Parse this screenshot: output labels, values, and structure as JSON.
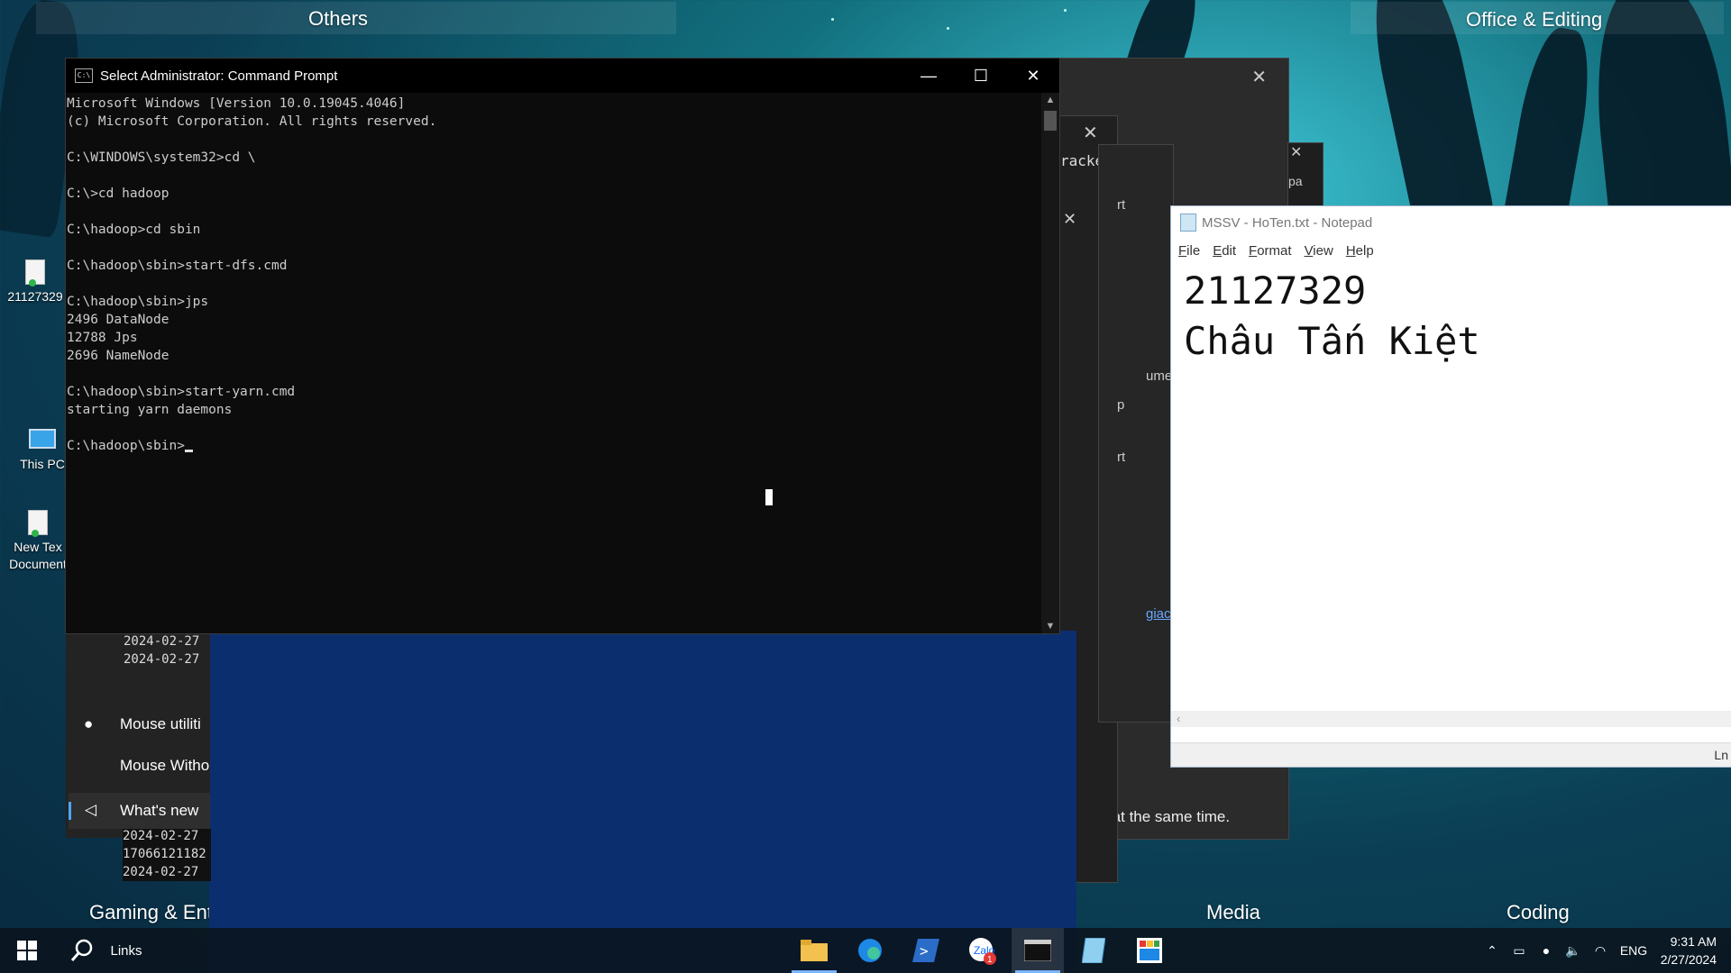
{
  "desktop": {
    "groups": {
      "others": "Others",
      "office": "Office & Editing",
      "gaming": "Gaming & Ent",
      "media": "Media",
      "coding": "Coding"
    },
    "icons": [
      {
        "label": "21127329",
        "icon": "text-document-icon"
      },
      {
        "label": "This PC",
        "icon": "this-pc-icon"
      },
      {
        "label": "New Tex Document",
        "icon": "text-document-icon"
      }
    ]
  },
  "background_windows": {
    "fragments": [
      "racke",
      "pa",
      "rt",
      "ume",
      "p",
      "rt",
      "giaco",
      "es at the same time."
    ],
    "log_lines_top": [
      "2024-02-27",
      "2024-02-27"
    ],
    "log_lines_bottom": [
      "2024-02-27",
      "17066121182",
      "2024-02-27"
    ],
    "start_items": [
      "Mouse utiliti",
      "Mouse Witho",
      "What's new"
    ]
  },
  "cmd": {
    "title": "Select Administrator: Command Prompt",
    "lines": [
      "Microsoft Windows [Version 10.0.19045.4046]",
      "(c) Microsoft Corporation. All rights reserved.",
      "",
      "C:\\WINDOWS\\system32>cd \\",
      "",
      "C:\\>cd hadoop",
      "",
      "C:\\hadoop>cd sbin",
      "",
      "C:\\hadoop\\sbin>start-dfs.cmd",
      "",
      "C:\\hadoop\\sbin>jps",
      "2496 DataNode",
      "12788 Jps",
      "2696 NameNode",
      "",
      "C:\\hadoop\\sbin>start-yarn.cmd",
      "starting yarn daemons",
      "",
      "C:\\hadoop\\sbin>"
    ]
  },
  "notepad": {
    "title": "MSSV - HoTen.txt - Notepad",
    "menu": [
      "File",
      "Edit",
      "Format",
      "View",
      "Help"
    ],
    "content": [
      "21127329",
      "Châu Tấn Kiệt"
    ],
    "status": "Ln"
  },
  "taskbar": {
    "search_label": "Links",
    "apps": [
      {
        "name": "file-explorer",
        "icon": "folder-icon"
      },
      {
        "name": "edge",
        "icon": "edge-icon"
      },
      {
        "name": "powershell",
        "icon": "powershell-icon"
      },
      {
        "name": "zalo",
        "icon": "zalo-icon",
        "badge": "1"
      },
      {
        "name": "command-prompt",
        "icon": "cmd-icon",
        "active": true
      },
      {
        "name": "notepad",
        "icon": "notepad-icon"
      },
      {
        "name": "paint",
        "icon": "paint-icon"
      }
    ],
    "language": "ENG",
    "time": "9:31 AM",
    "date": "2/27/2024"
  }
}
